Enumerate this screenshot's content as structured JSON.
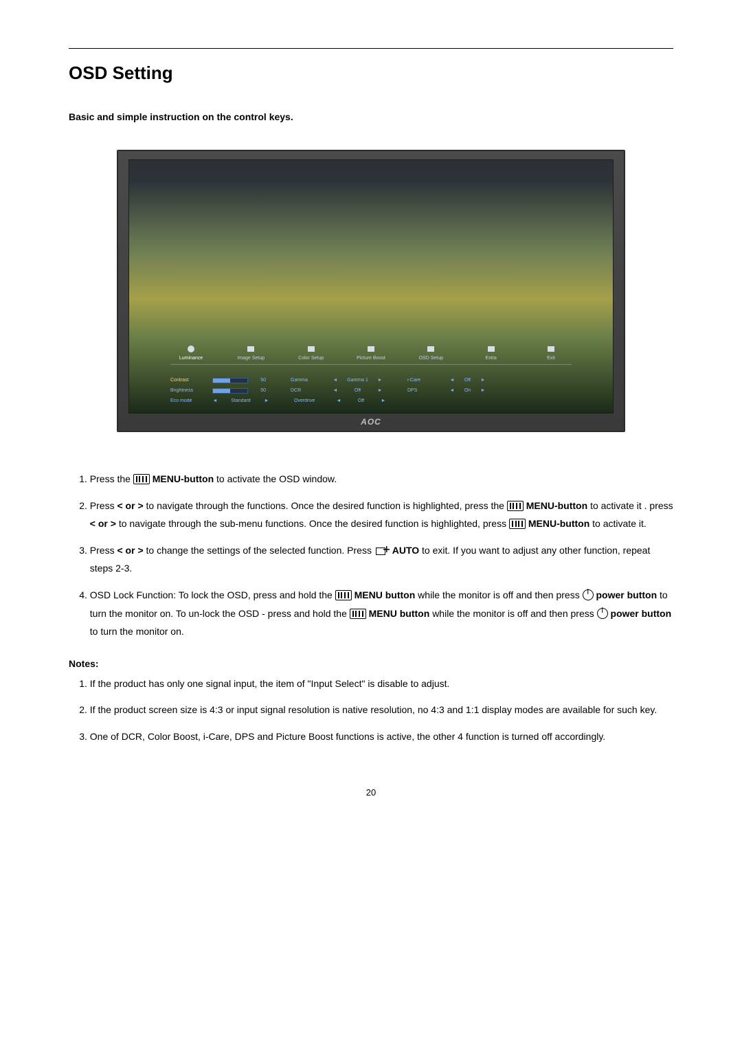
{
  "title": "OSD Setting",
  "subheading": "Basic and simple instruction on the control keys.",
  "osd": {
    "brand": "AOC",
    "tabs": [
      {
        "label": "Luminance",
        "active": true
      },
      {
        "label": "Image Setup",
        "active": false
      },
      {
        "label": "Color Setup",
        "active": false
      },
      {
        "label": "Picture Boost",
        "active": false
      },
      {
        "label": "OSD Setup",
        "active": false
      },
      {
        "label": "Extra",
        "active": false
      },
      {
        "label": "Exit",
        "active": false
      }
    ],
    "rows": [
      {
        "label": "Contrast",
        "type": "slider",
        "value": 50,
        "pair_label": "Gamma",
        "pair_value": "Gamma 1",
        "pair2_label": "i-Care",
        "pair2_value": "Off"
      },
      {
        "label": "Brightness",
        "type": "slider",
        "value": 50,
        "pair_label": "DCR",
        "pair_value": "Off",
        "pair2_label": "DPS",
        "pair2_value": "On"
      },
      {
        "label": "Eco mode",
        "type": "select",
        "value": "Standard",
        "pair_label": "Overdrive",
        "pair_value": "Off"
      }
    ]
  },
  "steps": {
    "s1a": "Press the ",
    "s1_menu": "MENU-button",
    "s1b": " to activate the OSD window.",
    "s2a": "Press ",
    "s2_lr": "< or >",
    "s2b": " to navigate through the functions. Once the desired function is highlighted, press the ",
    "s2_menu": "MENU-button",
    "s2c": " to activate it .   press ",
    "s2_lr2": "< or >",
    "s2d": " to navigate through the sub-menu functions. Once the desired function is highlighted, press ",
    "s2_menu2": "MENU-button",
    "s2e": " to activate it.",
    "s3a": "Press ",
    "s3_lr": "< or >",
    "s3b": " to change the settings of the selected function. Press ",
    "s3_auto": "AUTO",
    "s3c": " to exit.   If you want to adjust any other function, repeat steps 2-3.",
    "s4a": "OSD Lock Function: To lock the OSD, press and hold the ",
    "s4_menu": "MENU button",
    "s4b": " while the monitor is off and then press ",
    "s4_power": "power button",
    "s4c": " to turn the monitor on. To un-lock the OSD - press and hold the ",
    "s4_menu2": "MENU button",
    "s4d": " while the monitor is off and then press ",
    "s4_power2": "power button",
    "s4e": " to turn the monitor on."
  },
  "notes_heading": "Notes:",
  "notes": [
    "If the product has only one signal input, the item of \"Input Select\" is disable to adjust.",
    "If the product screen size is 4:3 or input signal resolution is native resolution, no 4:3 and 1:1 display modes are available for such key.",
    "One of DCR, Color Boost, i-Care, DPS and Picture Boost functions is active, the other 4 function is turned off accordingly."
  ],
  "page_number": "20"
}
